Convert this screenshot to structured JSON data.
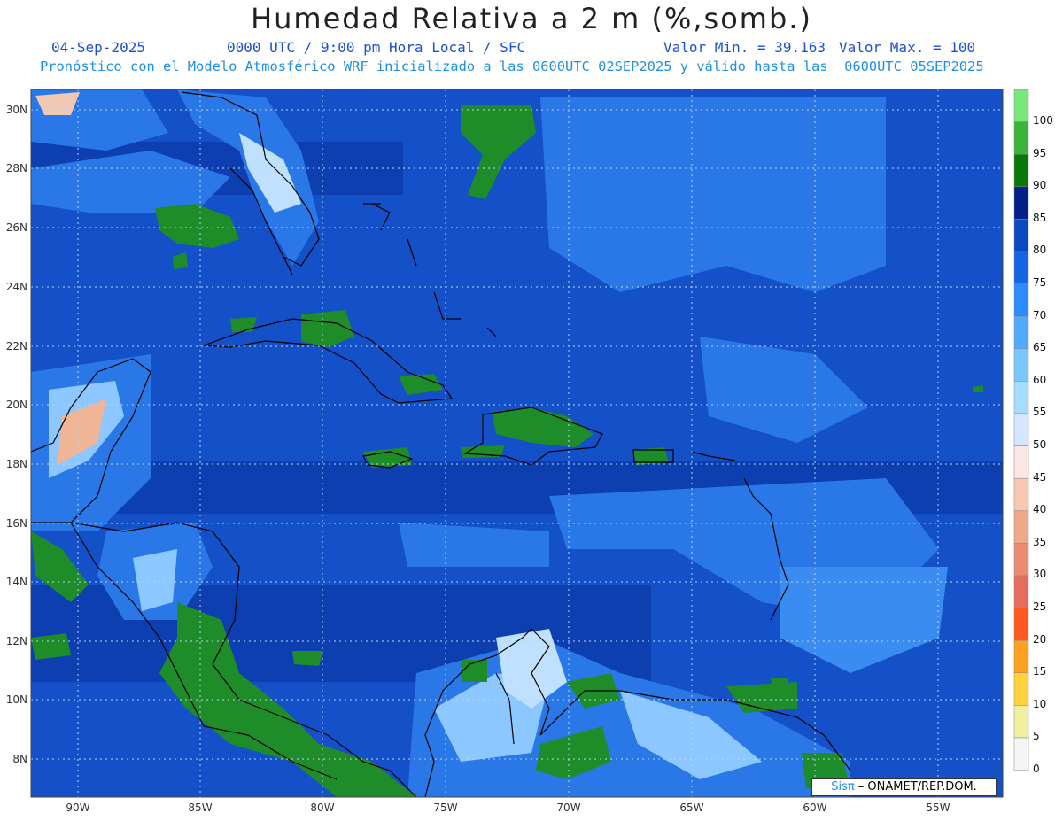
{
  "header": {
    "title": "Humedad Relativa a 2 m (%,somb.)",
    "date": "04-Sep-2025",
    "time_label": "0000 UTC / 9:00 pm Hora Local / SFC",
    "min_value": "Valor Min. = 39.163",
    "max_value": "Valor Max. = 100",
    "model_line": "Pronóstico con el Modelo Atmosférico WRF inicializado a las 0600UTC_02SEP2025 y válido hasta las  0600UTC_05SEP2025"
  },
  "map": {
    "lat_labels": [
      "30N",
      "28N",
      "26N",
      "24N",
      "22N",
      "20N",
      "18N",
      "16N",
      "14N",
      "12N",
      "10N",
      "8N"
    ],
    "lon_labels": [
      "90W",
      "85W",
      "80W",
      "75W",
      "70W",
      "65W",
      "60W",
      "55W"
    ],
    "grid": "dotted",
    "colors": {
      "ocean_base": "#1450c8",
      "dark": "#0a3aa0",
      "mid": "#2878ee",
      "light": "#8cc8ff",
      "green": "#1e8c28",
      "land_light": "#dcecff",
      "tan": "#f0b496"
    }
  },
  "colorbar": {
    "levels": [
      "100",
      "95",
      "90",
      "85",
      "80",
      "75",
      "70",
      "65",
      "60",
      "55",
      "50",
      "45",
      "40",
      "35",
      "30",
      "25",
      "20",
      "15",
      "10",
      "5",
      "0"
    ],
    "colors": [
      "#78e678",
      "#3cb43c",
      "#087808",
      "#06208a",
      "#0a4ac0",
      "#1466e6",
      "#2a8cff",
      "#50aaff",
      "#7ac6ff",
      "#a6dcff",
      "#d4e6ff",
      "#fce6e6",
      "#f8c8b0",
      "#f0a888",
      "#ec8a72",
      "#e86c5e",
      "#ff5a1e",
      "#ffa01e",
      "#ffd23c",
      "#f0f0a0",
      "#f5f5f5"
    ]
  },
  "credit": {
    "sis": "Sisπ",
    "rest": " – ONAMET/REP.DOM."
  }
}
